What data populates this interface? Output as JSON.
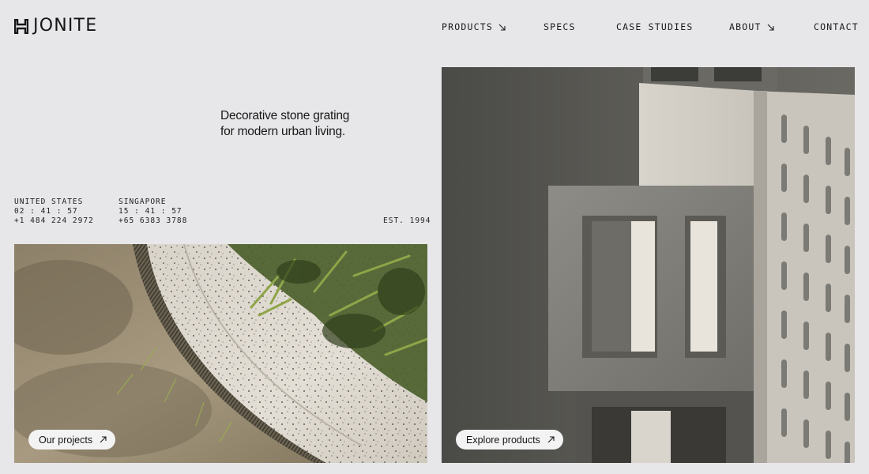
{
  "brand": {
    "name": "JONITE",
    "color": "#151515"
  },
  "nav": {
    "items": [
      {
        "label": "PRODUCTS",
        "icon": "arrow-down-right-icon"
      },
      {
        "label": "SPECS"
      },
      {
        "label": "CASE STUDIES"
      },
      {
        "label": "ABOUT",
        "icon": "arrow-down-right-icon"
      },
      {
        "label": "CONTACT"
      }
    ]
  },
  "hero": {
    "tagline_line1": "Decorative stone grating",
    "tagline_line2": "for modern urban living."
  },
  "offices": [
    {
      "country": "UNITED STATES",
      "time": "02 : 41 : 57",
      "phone": "+1 484 224 2972"
    },
    {
      "country": "SINGAPORE",
      "time": "15 : 41 : 57",
      "phone": "+65 6383 3788"
    }
  ],
  "established": "EST. 1994",
  "cards": {
    "projects": {
      "label": "Our projects",
      "icon": "arrow-up-right-icon"
    },
    "products": {
      "label": "Explore products",
      "icon": "arrow-up-right-icon"
    }
  },
  "colors": {
    "background": "#e7e7e9",
    "pill": "#f3f3f3",
    "text": "#151515"
  }
}
